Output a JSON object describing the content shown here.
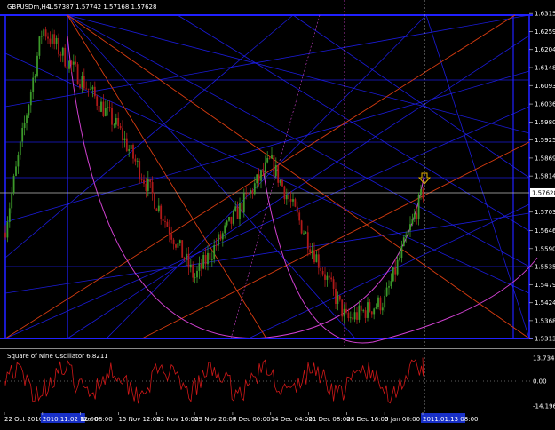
{
  "header": {
    "symbol": "GBPUSDm,H4",
    "ohlc": "1.57387 1.57742 1.57168 1.57628"
  },
  "current_price_label": "1.57628",
  "oscillator": {
    "title": "Square of Nine Oscillator 6.8211",
    "ticks": [
      "13.7346",
      "0.00",
      "-14.196"
    ]
  },
  "colors": {
    "background": "#000000",
    "bull_candle": "#3c9a2a",
    "bear_candle": "#b01919",
    "gann_lines": "#2020ff",
    "fan_lines": "#d83c10",
    "arcs": "#d040d0",
    "oscillator_line": "#d01818",
    "current_price_box": "#ffffff",
    "down_arrow": "#e0b000"
  },
  "time_axis": {
    "labels": [
      "22 Oct 2010",
      "2010.11.02 12:00",
      "Nov 08:00",
      "15 Nov 12:00",
      "22 Nov 16:00",
      "29 Nov 20:00",
      "7 Dec 00:00",
      "14 Dec 04:00",
      "21 Dec 08:00",
      "28 Dec 16:00",
      "5 Jan 00:00",
      "2011.01.13 08:00"
    ],
    "highlighted": [
      "2010.11.02 12:00",
      "2011.01.13 08:00"
    ]
  },
  "chart_data": [
    {
      "type": "candlestick",
      "title": "GBPUSDm,H4",
      "y_ticks": [
        "1.63153",
        "1.62598",
        "1.62043",
        "1.61488",
        "1.60933",
        "1.60363",
        "1.59808",
        "1.59253",
        "1.58698",
        "1.58143",
        "1.57033",
        "1.56463",
        "1.55908",
        "1.55353",
        "1.54798",
        "1.54240",
        "1.53688",
        "1.53133"
      ],
      "ylim": [
        1.53,
        1.6335
      ],
      "key_points": [
        {
          "time": "22 Oct 2010",
          "price": 1.564
        },
        {
          "time": "2010.11.02 12:00",
          "price": 1.627
        },
        {
          "time": "15 Nov 12:00",
          "price": 1.596
        },
        {
          "time": "29 Nov 20:00",
          "price": 1.55
        },
        {
          "time": "14 Dec 04:00",
          "price": 1.586
        },
        {
          "time": "28 Dec 16:00",
          "price": 1.537
        },
        {
          "time": "5 Jan 00:00",
          "price": 1.543
        },
        {
          "time": "2011.01.13 08:00",
          "price": 1.57628
        }
      ],
      "last_price": 1.57628,
      "grid": false
    },
    {
      "type": "line",
      "title": "Square of Nine Oscillator 6.8211",
      "ylim": [
        -14.196,
        13.7346
      ],
      "zero_line": 0.0,
      "grid": false
    }
  ]
}
